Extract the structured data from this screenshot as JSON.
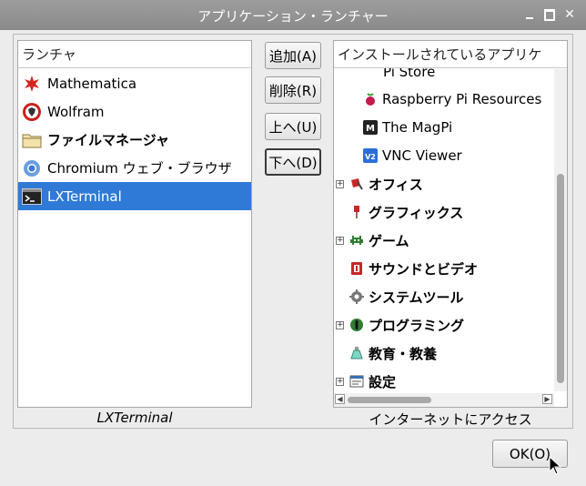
{
  "window": {
    "title": "アプリケーション・ランチャー",
    "controls": {
      "close": "✕"
    }
  },
  "left_list": {
    "header": "ランチャ",
    "items": [
      {
        "label": "Mathematica",
        "icon": "mathematica-icon"
      },
      {
        "label": "Wolfram",
        "icon": "wolfram-icon"
      },
      {
        "label": "ファイルマネージャ",
        "icon": "folder-icon"
      },
      {
        "label": "Chromium ウェブ・ブラウザ",
        "icon": "chromium-icon"
      },
      {
        "label": "LXTerminal",
        "icon": "terminal-icon",
        "selected": true
      }
    ],
    "caption": "LXTerminal"
  },
  "buttons": {
    "add": "追加(A)",
    "remove": "削除(R)",
    "up": "上へ(U)",
    "down": "下へ(D)"
  },
  "right_tree": {
    "header": "インストールされているアプリケ",
    "items": [
      {
        "label": "Pi Store",
        "icon": "pi-store-icon"
      },
      {
        "label": "Raspberry Pi Resources",
        "icon": "raspberry-icon"
      },
      {
        "label": "The MagPi",
        "icon": "magpi-icon"
      },
      {
        "label": "VNC Viewer",
        "icon": "vnc-icon"
      }
    ],
    "categories": [
      {
        "label": "オフィス",
        "icon": "office-icon",
        "expandable": true
      },
      {
        "label": "グラフィックス",
        "icon": "graphics-icon",
        "expandable": false
      },
      {
        "label": "ゲーム",
        "icon": "game-icon",
        "expandable": true
      },
      {
        "label": "サウンドとビデオ",
        "icon": "sound-video-icon",
        "expandable": false
      },
      {
        "label": "システムツール",
        "icon": "system-tools-icon",
        "expandable": false
      },
      {
        "label": "プログラミング",
        "icon": "programming-icon",
        "expandable": true
      },
      {
        "label": "教育・教養",
        "icon": "education-icon",
        "expandable": false
      },
      {
        "label": "設定",
        "icon": "settings-icon",
        "expandable": true
      }
    ],
    "expander_symbol": "+",
    "caption": "インターネットにアクセス"
  },
  "ok_button": "OK(O)",
  "colors": {
    "selection": "#2e7ad6",
    "titlebar": "#8f8f8f"
  }
}
